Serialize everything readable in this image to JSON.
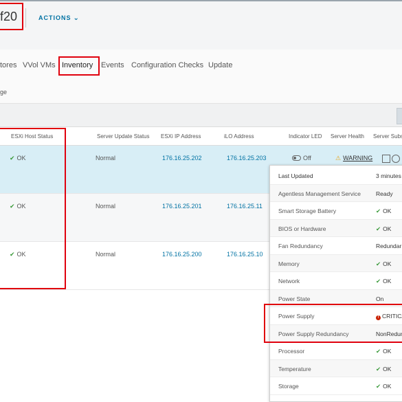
{
  "header": {
    "title": "f20",
    "actions_label": "ACTIONS"
  },
  "tabs": [
    {
      "label": "tores"
    },
    {
      "label": "VVol VMs"
    },
    {
      "label": "Inventory",
      "active": true
    },
    {
      "label": "Events"
    },
    {
      "label": "Configuration Checks"
    },
    {
      "label": "Update"
    }
  ],
  "subnav": {
    "label": "ge"
  },
  "columns": {
    "esxi_host_status": "ESXi Host Status",
    "server_update_status": "Server Update Status",
    "esxi_ip": "ESXi IP Address",
    "ilo": "iLO Address",
    "indicator_led": "Indicator LED",
    "server_health": "Server Health",
    "server_subsystems": "Server Subs"
  },
  "rows": [
    {
      "status": "OK",
      "update_status": "Normal",
      "esxi_ip": "176.16.25.202",
      "ilo": "176.16.25.203",
      "led": "Off",
      "health": "WARNING",
      "selected": true
    },
    {
      "status": "OK",
      "update_status": "Normal",
      "esxi_ip": "176.16.25.201",
      "ilo": "176.16.25.11"
    },
    {
      "status": "OK",
      "update_status": "Normal",
      "esxi_ip": "176.16.25.200",
      "ilo": "176.16.25.10"
    }
  ],
  "popover": {
    "items": [
      {
        "label": "Last Updated",
        "value": "3 minutes"
      },
      {
        "label": "Agentless Management Service",
        "value": "Ready"
      },
      {
        "label": "Smart Storage Battery",
        "value": "OK"
      },
      {
        "label": "BIOS or Hardware",
        "value": "OK"
      },
      {
        "label": "Fan Redundancy",
        "value": "Redundar"
      },
      {
        "label": "Memory",
        "value": "OK"
      },
      {
        "label": "Network",
        "value": "OK"
      },
      {
        "label": "Power State",
        "value": "On"
      },
      {
        "label": "Power Supply",
        "value": "CRITICA"
      },
      {
        "label": "Power Supply Redundancy",
        "value": "NonRedun"
      },
      {
        "label": "Processor",
        "value": "OK"
      },
      {
        "label": "Temperature",
        "value": "OK"
      },
      {
        "label": "Storage",
        "value": "OK"
      }
    ]
  },
  "colors": {
    "highlight": "#e0000d",
    "link": "#0072a3",
    "ok": "#3c9b3c",
    "critical": "#c92100",
    "warning": "#e8a317",
    "selected_row": "#d8eef6"
  }
}
